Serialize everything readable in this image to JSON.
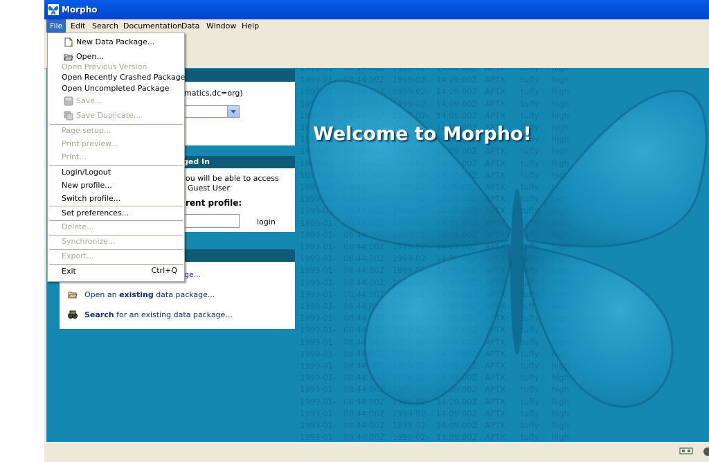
{
  "window": {
    "title": "Morpho"
  },
  "menubar": [
    "File",
    "Edit",
    "Search",
    "Documentation",
    "Data",
    "Window",
    "Help"
  ],
  "file_menu": {
    "new_data_package": "New Data Package...",
    "open": "Open...",
    "open_previous_version": "Open Previous Version",
    "open_recently_crashed": "Open Recently Crashed Package",
    "open_uncompleted": "Open Uncompleted Package",
    "save": "Save...",
    "save_duplicate": "Save Duplicate...",
    "page_setup": "Page setup...",
    "print_preview": "Print preview...",
    "print": "Print...",
    "login_logout": "Login/Logout",
    "new_profile": "New profile...",
    "switch_profile": "Switch profile...",
    "set_preferences": "Set preferences...",
    "delete": "Delete...",
    "synchronize": "Synchronize...",
    "export": "Export...",
    "exit": "Exit",
    "exit_shortcut": "Ctrl+Q"
  },
  "panel_network": {
    "org_fragment": "matics,dc=org)"
  },
  "panel_login": {
    "header_fragment": "ged In",
    "line1": "ou will be able to access",
    "line2": "Guest User",
    "profile_label": "rent profile:",
    "login_button": "login"
  },
  "panel_packages": {
    "new_fragment": "ge...",
    "open_prefix": "Open an ",
    "open_bold": "existing",
    "open_suffix": " data package...",
    "search_bold": "Search",
    "search_suffix": " for an existing data package..."
  },
  "welcome": "Welcome to Morpho!",
  "background_table": {
    "row_a": "1999-01-   08:44:00Z   1999-02-   14:09:00Z   APTX      tuffy     high",
    "row_b": "1999-01-   08:44:00Z   1999-02-   14:09:00Z   APTX      tuffy     high"
  },
  "colors": {
    "content_bg": "#1588b2",
    "panel_header": "#0f5a77",
    "menu_highlight": "#316ac5"
  }
}
